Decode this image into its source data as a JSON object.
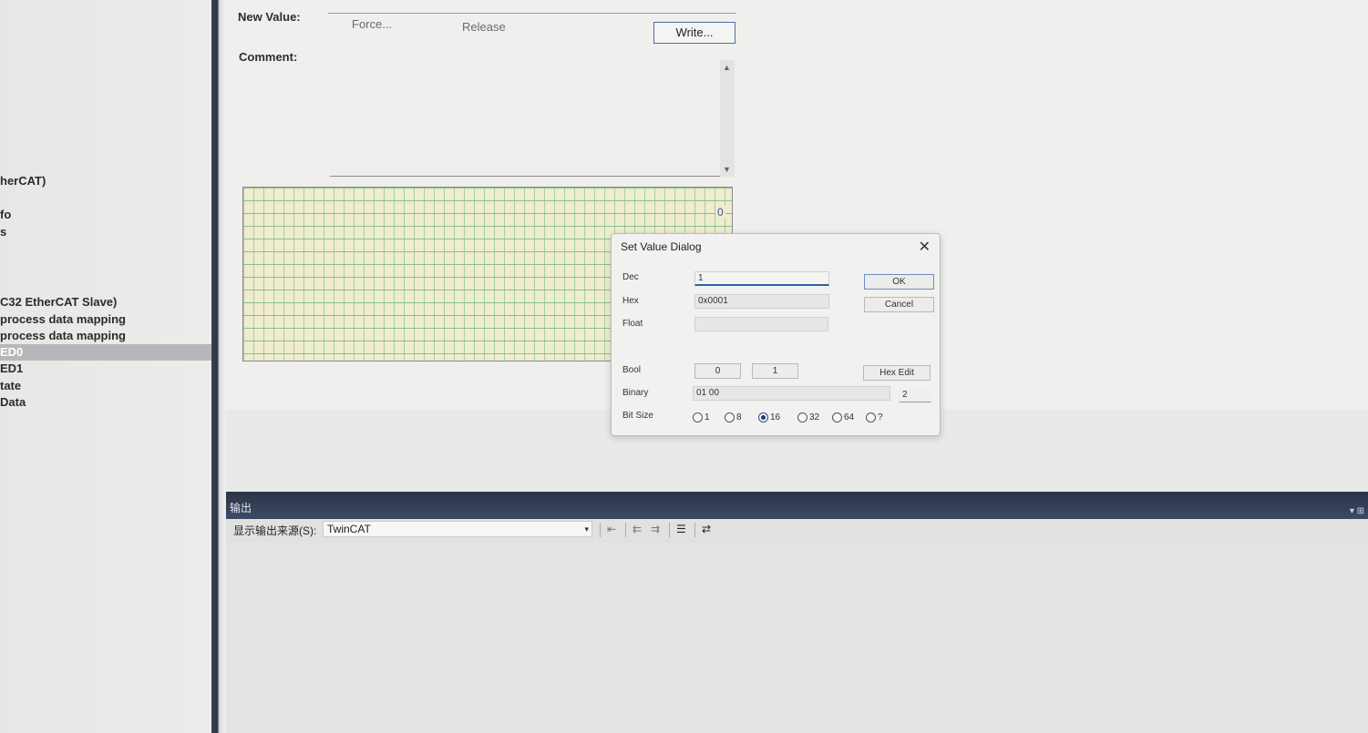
{
  "tree": {
    "items": [
      {
        "label": "herCAT)",
        "selected": false
      },
      {
        "label": "fo",
        "selected": false
      },
      {
        "label": "s",
        "selected": false
      },
      {
        "label": "C32 EtherCAT Slave)",
        "selected": false
      },
      {
        "label": "process data mapping",
        "selected": false
      },
      {
        "label": "process data mapping",
        "selected": false
      },
      {
        "label": "ED0",
        "selected": true
      },
      {
        "label": "ED1",
        "selected": false
      },
      {
        "label": "tate",
        "selected": false
      },
      {
        "label": "Data",
        "selected": false
      }
    ]
  },
  "editor": {
    "new_value_label": "New Value:",
    "force_label": "Force...",
    "release_label": "Release",
    "write_label": "Write...",
    "comment_label": "Comment:",
    "comment_value": "",
    "grid_value": "0"
  },
  "dialog": {
    "title": "Set Value Dialog",
    "close_glyph": "✕",
    "dec_label": "Dec",
    "dec_value": "1",
    "hex_label": "Hex",
    "hex_value": "0x0001",
    "float_label": "Float",
    "float_value": "",
    "ok_label": "OK",
    "cancel_label": "Cancel",
    "bool_label": "Bool",
    "bool_false_label": "0",
    "bool_true_label": "1",
    "hex_edit_label": "Hex Edit",
    "binary_label": "Binary",
    "binary_value": "01 00",
    "binary_size_value": "2",
    "bitsize_label": "Bit Size",
    "bitsize_options": [
      "1",
      "8",
      "16",
      "32",
      "64",
      "?"
    ],
    "bitsize_selected": "16"
  },
  "output": {
    "title": "输出",
    "title_icons": "▾ ⊞",
    "source_label": "显示输出来源(S):",
    "source_value": "TwinCAT",
    "source_caret": "▾",
    "toolbar_icons": [
      "⇤",
      "⇇",
      "⇉",
      "☰",
      "⇄"
    ]
  }
}
